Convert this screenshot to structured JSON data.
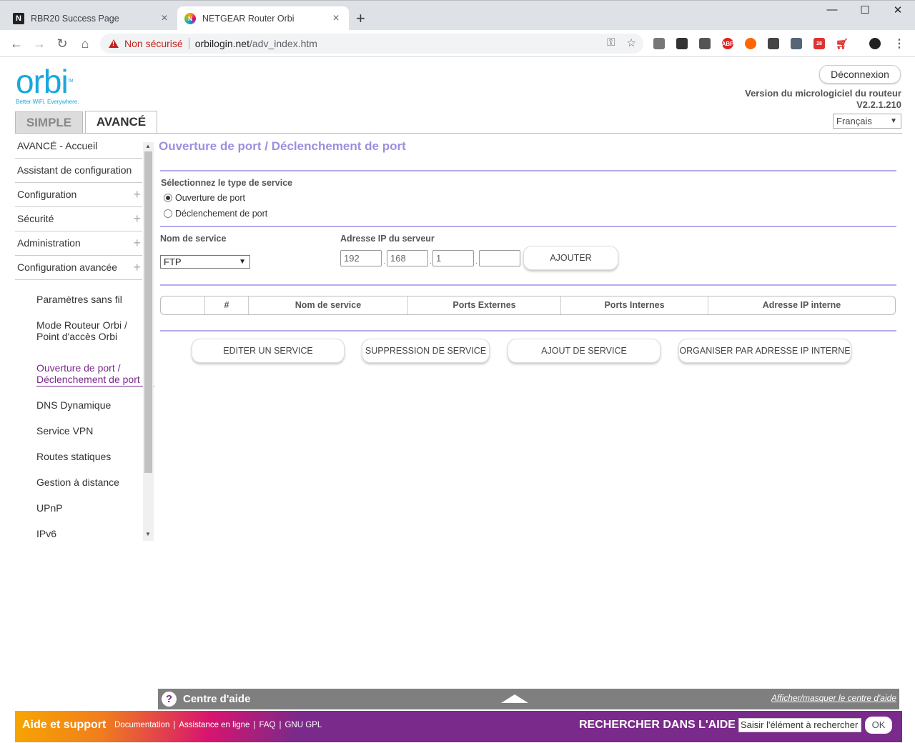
{
  "browser": {
    "tabs": [
      {
        "title": "RBR20 Success Page",
        "favicon": "N"
      },
      {
        "title": "NETGEAR Router Orbi",
        "favicon": "N"
      }
    ],
    "address": {
      "security": "Non sécurisé",
      "host": "orbilogin.net",
      "path": "/adv_index.htm"
    },
    "extension_badges": {
      "abp": "ABP",
      "gmail_count": "28"
    }
  },
  "header": {
    "logo_word": "orbi",
    "logo_tm": "TM",
    "logo_tagline": "Better WiFi. Everywhere.",
    "logout_label": "Déconnexion",
    "firmware_label": "Version du micrologiciel du routeur",
    "firmware_version": "V2.2.1.210",
    "language": "Français",
    "tab_simple": "SIMPLE",
    "tab_advanced": "AVANCÉ"
  },
  "sidebar": {
    "items": [
      {
        "label": "AVANCÉ - Accueil",
        "expandable": false
      },
      {
        "label": "Assistant de configuration",
        "expandable": false
      },
      {
        "label": "Configuration",
        "expandable": true
      },
      {
        "label": "Sécurité",
        "expandable": true
      },
      {
        "label": "Administration",
        "expandable": true
      },
      {
        "label": "Configuration avancée",
        "expandable": true
      }
    ],
    "sub_items": [
      {
        "line1": "Paramètres sans fil",
        "line2": ""
      },
      {
        "line1": "Mode Routeur Orbi /",
        "line2": "Point d'accès Orbi"
      },
      {
        "line1": "Ouverture de port /",
        "line2": "Déclenchement de port"
      },
      {
        "line1": "DNS Dynamique",
        "line2": ""
      },
      {
        "line1": "Service VPN",
        "line2": ""
      },
      {
        "line1": "Routes statiques",
        "line2": ""
      },
      {
        "line1": "Gestion à distance",
        "line2": ""
      },
      {
        "line1": "UPnP",
        "line2": ""
      },
      {
        "line1": "IPv6",
        "line2": ""
      }
    ],
    "plus_glyph": "+"
  },
  "main": {
    "title": "Ouverture de port / Déclenchement de port",
    "service_type_label": "Sélectionnez le type de service",
    "radio_port_forwarding": "Ouverture de port",
    "radio_port_triggering": "Déclenchement de port",
    "service_name_label": "Nom de service",
    "service_name_value": "FTP",
    "server_ip_label": "Adresse IP du serveur",
    "ip": [
      "192",
      "168",
      "1",
      ""
    ],
    "add_button": "AJOUTER",
    "table_headers": [
      "",
      "#",
      "Nom de service",
      "Ports Externes",
      "Ports Internes",
      "Adresse IP interne"
    ],
    "buttons": {
      "edit": "EDITER UN SERVICE",
      "delete": "SUPPRESSION DE SERVICE",
      "add": "AJOUT DE SERVICE",
      "sort": "ORGANISER PAR ADRESSE IP INTERNE"
    }
  },
  "helpbar": {
    "title": "Centre d'aide",
    "toggle": "Afficher/masquer le centre d'aide"
  },
  "footer": {
    "title": "Aide et support",
    "links": [
      "Documentation",
      "Assistance en ligne",
      "FAQ",
      "GNU GPL"
    ],
    "search_label": "RECHERCHER DANS L'AIDE",
    "search_value": "Saisir l'élément à rechercher",
    "ok": "OK"
  },
  "colors": {
    "accent_purple": "#7a2a8a",
    "title_lavender": "#9b8fe0",
    "orbi_blue": "#1aa7df"
  }
}
